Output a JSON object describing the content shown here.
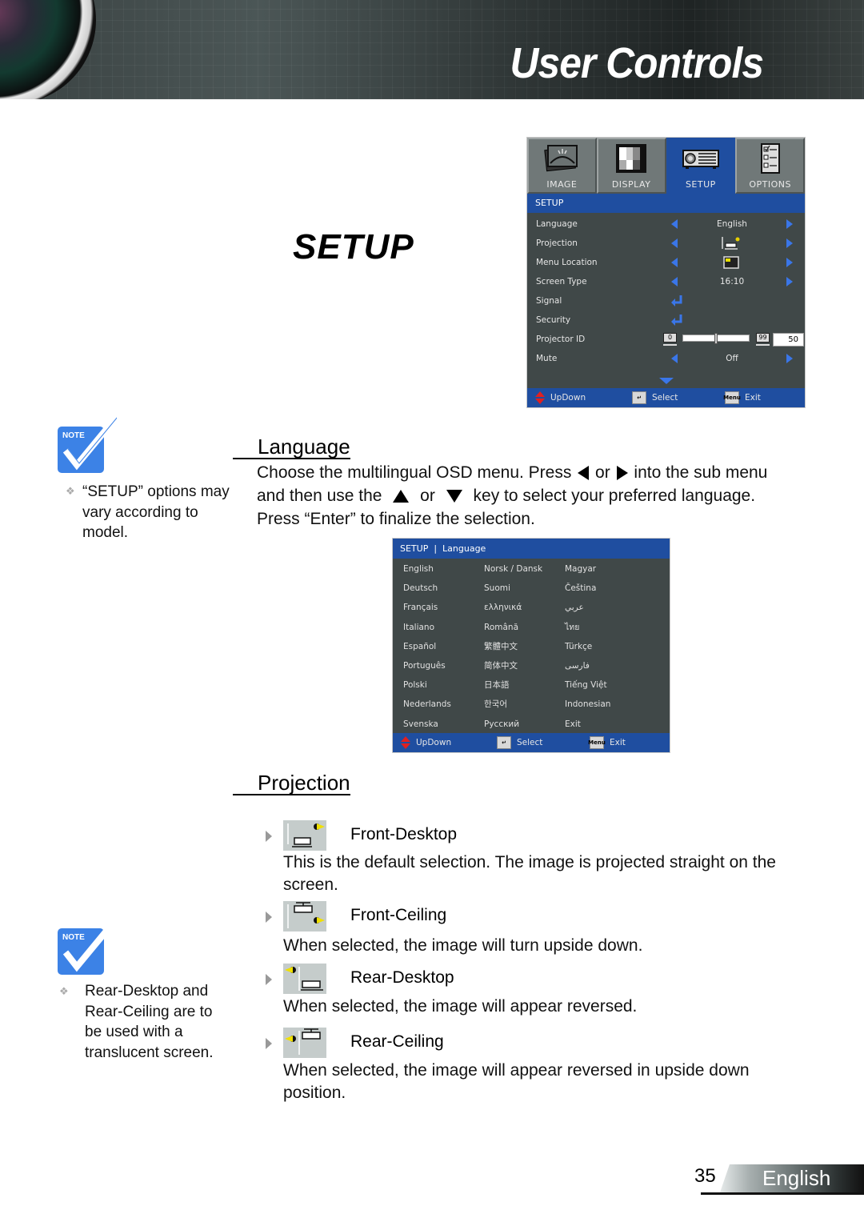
{
  "header": {
    "title": "User Controls"
  },
  "page_heading": "SETUP",
  "osd": {
    "tabs": [
      {
        "label": "IMAGE",
        "icon": "image-icon",
        "active": false
      },
      {
        "label": "DISPLAY",
        "icon": "display-icon",
        "active": false
      },
      {
        "label": "SETUP",
        "icon": "projector-icon",
        "active": true
      },
      {
        "label": "OPTIONS",
        "icon": "options-checklist-icon",
        "active": false
      }
    ],
    "section_title": "SETUP",
    "rows": [
      {
        "label": "Language",
        "value": "English",
        "control": "arrows"
      },
      {
        "label": "Projection",
        "value": "front-desktop-icon",
        "control": "arrows"
      },
      {
        "label": "Menu Location",
        "value": "menu-location-icon",
        "control": "arrows"
      },
      {
        "label": "Screen Type",
        "value": "16:10",
        "control": "arrows"
      },
      {
        "label": "Signal",
        "value": "",
        "control": "enter"
      },
      {
        "label": "Security",
        "value": "",
        "control": "enter"
      },
      {
        "label": "Projector ID",
        "value": "50",
        "control": "slider",
        "min": "0",
        "max": "99",
        "fraction": 0.5
      },
      {
        "label": "Mute",
        "value": "Off",
        "control": "arrows"
      }
    ],
    "footer": {
      "updown": "UpDown",
      "select": "Select",
      "exit": "Exit",
      "menu_key": "Menu"
    }
  },
  "notes": [
    {
      "badge": "Note",
      "text": "“SETUP” options may vary according to model."
    },
    {
      "badge": "Note",
      "text": "Rear-Desktop and Rear-Ceiling are to be used with a translucent screen."
    }
  ],
  "language_section": {
    "title": "Language",
    "text_parts": [
      "Choose the multilingual OSD menu. Press",
      "or",
      "into the sub menu and then use the",
      "or",
      "key to select your preferred language. Press “Enter” to finalize the selection."
    ],
    "submenu": {
      "title": "SETUP  |  Language",
      "languages": [
        "English",
        "Norsk / Dansk",
        "Magyar",
        "Deutsch",
        "Suomi",
        "Čeština",
        "Français",
        "ελληνικά",
        "عربي",
        "Italiano",
        "Română",
        "ไทย",
        "Español",
        "繁體中文",
        "Türkçe",
        "Português",
        "简体中文",
        "فارسی",
        "Polski",
        "日本語",
        "Tiếng Việt",
        "Nederlands",
        "한국어",
        "Indonesian",
        "Svenska",
        "Русский",
        "Exit"
      ],
      "footer": {
        "updown": "UpDown",
        "select": "Select",
        "exit": "Exit",
        "menu_key": "Menu"
      }
    }
  },
  "projection_section": {
    "title": "Projection",
    "options": [
      {
        "label": "Front-Desktop",
        "icon": "front-desktop-icon",
        "description": "This is the default selection. The image is projected straight on the screen."
      },
      {
        "label": "Front-Ceiling",
        "icon": "front-ceiling-icon",
        "description": "When selected, the image will turn upside down."
      },
      {
        "label": "Rear-Desktop",
        "icon": "rear-desktop-icon",
        "description": "When selected, the image will appear reversed."
      },
      {
        "label": "Rear-Ceiling",
        "icon": "rear-ceiling-icon",
        "description": "When selected, the image will appear reversed in upside down position."
      }
    ]
  },
  "footer": {
    "page_number": "35",
    "language": "English"
  },
  "colors": {
    "osd_blue": "#1f4ea0",
    "osd_bg": "#404848",
    "osd_arrow": "#3a76e8",
    "note_blue": "#3c82e6"
  }
}
